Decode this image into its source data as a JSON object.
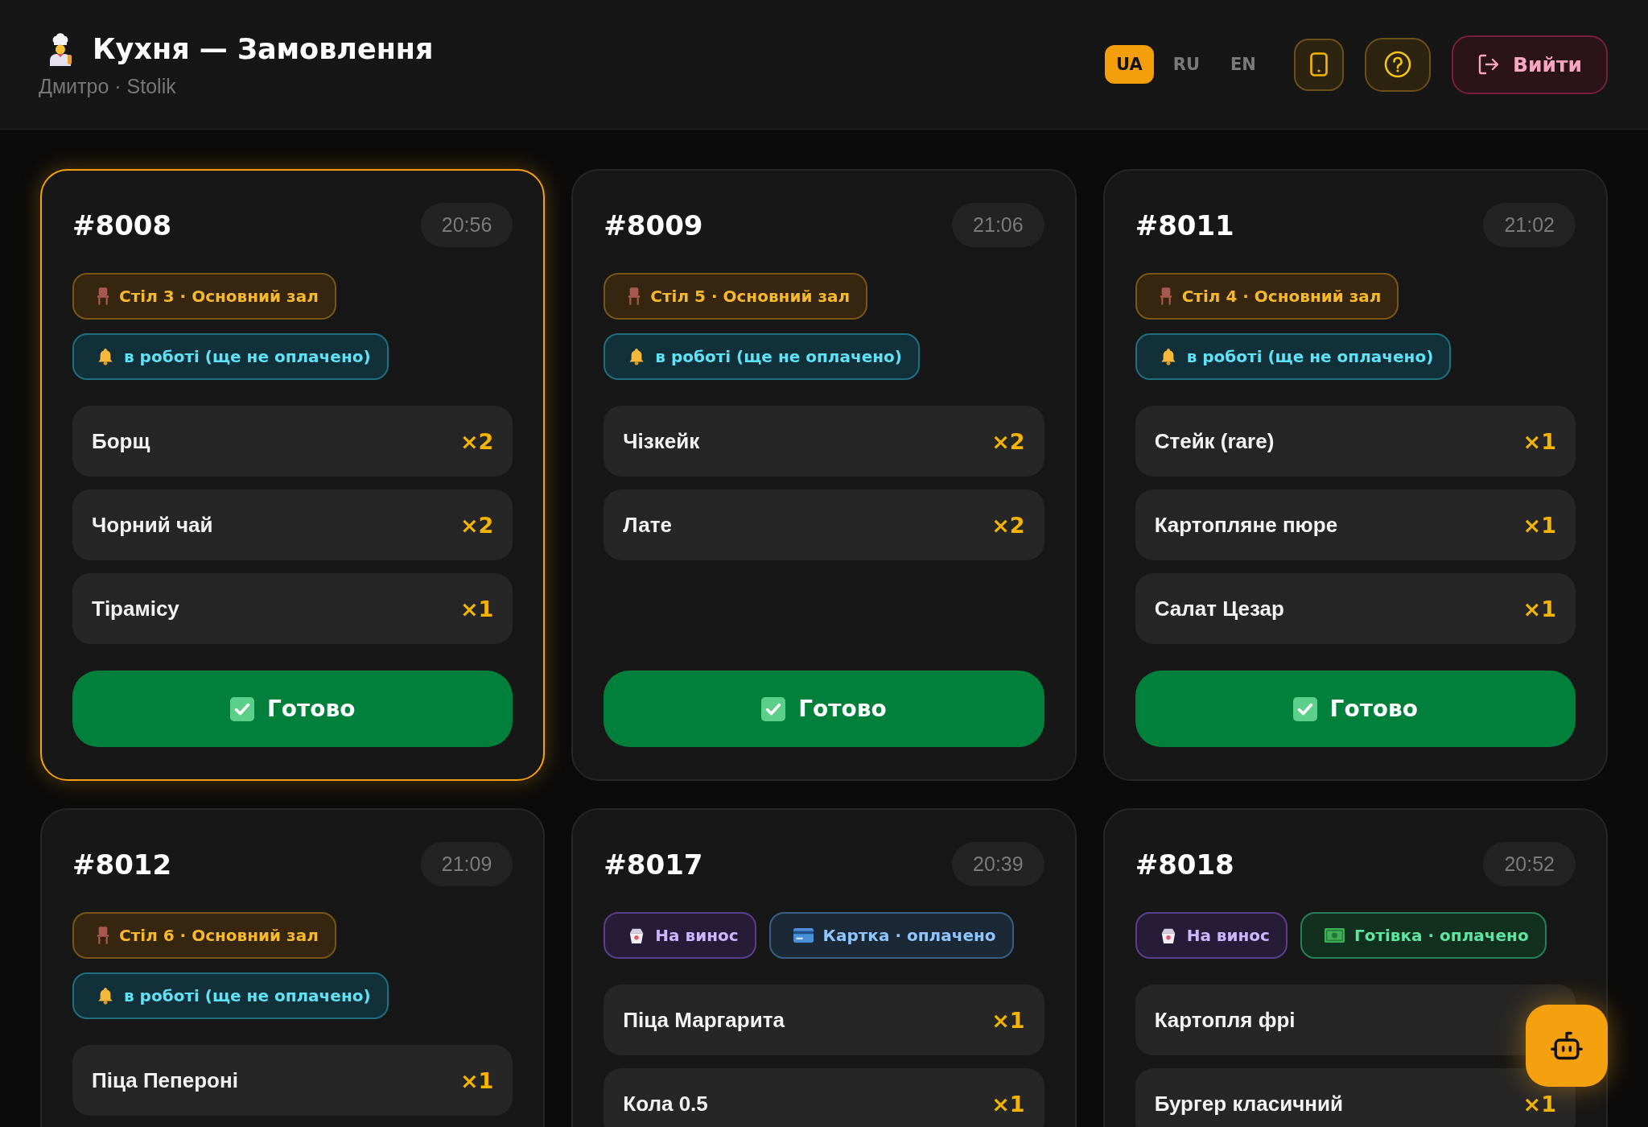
{
  "header": {
    "title": "Кухня — Замовлення",
    "subtitle": "Дмитро · Stolik",
    "languages": [
      {
        "label": "UA",
        "selected": true
      },
      {
        "label": "RU",
        "selected": false
      },
      {
        "label": "EN",
        "selected": false
      }
    ],
    "logout": "Вийти"
  },
  "orders": [
    {
      "number": "#8008",
      "time": "20:56",
      "highlighted": true,
      "badges": [
        {
          "kind": "table",
          "text": "Стіл 3 · Основний зал"
        },
        {
          "kind": "status",
          "text": "в роботі (ще не оплачено)"
        }
      ],
      "items": [
        {
          "name": "Борщ",
          "qty": "×2"
        },
        {
          "name": "Чорний чай",
          "qty": "×2"
        },
        {
          "name": "Тірамісу",
          "qty": "×1"
        }
      ],
      "action": "Готово"
    },
    {
      "number": "#8009",
      "time": "21:06",
      "highlighted": false,
      "badges": [
        {
          "kind": "table",
          "text": "Стіл 5 · Основний зал"
        },
        {
          "kind": "status",
          "text": "в роботі (ще не оплачено)"
        }
      ],
      "items": [
        {
          "name": "Чізкейк",
          "qty": "×2"
        },
        {
          "name": "Лате",
          "qty": "×2"
        }
      ],
      "action": "Готово"
    },
    {
      "number": "#8011",
      "time": "21:02",
      "highlighted": false,
      "badges": [
        {
          "kind": "table",
          "text": "Стіл 4 · Основний зал"
        },
        {
          "kind": "status",
          "text": "в роботі (ще не оплачено)"
        }
      ],
      "items": [
        {
          "name": "Стейк (rare)",
          "qty": "×1"
        },
        {
          "name": "Картопляне пюре",
          "qty": "×1"
        },
        {
          "name": "Салат Цезар",
          "qty": "×1"
        }
      ],
      "action": "Готово"
    },
    {
      "number": "#8012",
      "time": "21:09",
      "highlighted": false,
      "badges": [
        {
          "kind": "table",
          "text": "Стіл 6 · Основний зал"
        },
        {
          "kind": "status",
          "text": "в роботі (ще не оплачено)"
        }
      ],
      "items": [
        {
          "name": "Піца Пепероні",
          "qty": "×1"
        }
      ]
    },
    {
      "number": "#8017",
      "time": "20:39",
      "highlighted": false,
      "badges": [
        {
          "kind": "takeaway",
          "text": "На винос"
        },
        {
          "kind": "card",
          "text": "Картка · оплачено"
        }
      ],
      "items": [
        {
          "name": "Піца Маргарита",
          "qty": "×1"
        },
        {
          "name": "Кола 0.5",
          "qty": "×1"
        }
      ]
    },
    {
      "number": "#8018",
      "time": "20:52",
      "highlighted": false,
      "badges": [
        {
          "kind": "takeaway",
          "text": "На винос"
        },
        {
          "kind": "cash",
          "text": "Готівка · оплачено"
        }
      ],
      "items": [
        {
          "name": "Картопля фрі"
        },
        {
          "name": "Бургер класичний",
          "qty": "×1"
        }
      ]
    }
  ]
}
